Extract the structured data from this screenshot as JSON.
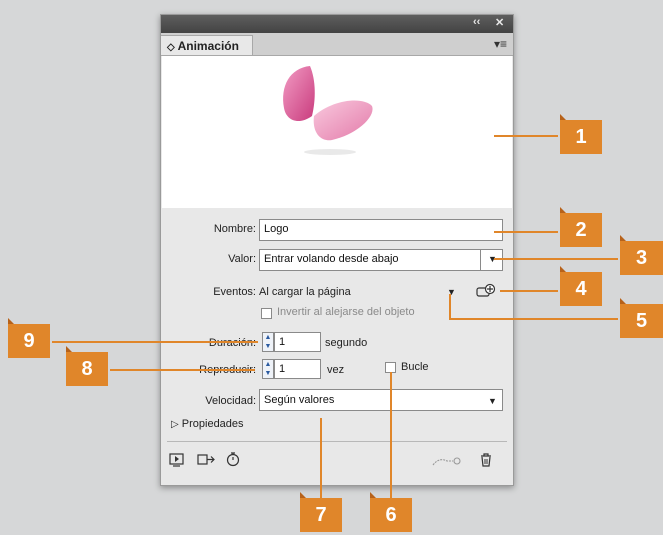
{
  "panel": {
    "tab_label": "Animación",
    "tab_arrows": "◇",
    "collapse_icon": "‹‹",
    "close_icon": "✕",
    "menu_icon": "▾≡"
  },
  "form": {
    "name_label": "Nombre:",
    "name_value": "Logo",
    "value_label": "Valor:",
    "value_value": "Entrar volando desde abajo",
    "events_label": "Eventos:",
    "events_value": "Al cargar la página",
    "invert_label": "Invertir al alejarse del objeto",
    "duration_label": "Duración:",
    "duration_value": "1",
    "duration_unit": "segundo",
    "repeat_label": "Reproducir:",
    "repeat_value": "1",
    "repeat_unit": "vez",
    "loop_label": "Bucle",
    "speed_label": "Velocidad:",
    "speed_value": "Según valores",
    "properties_label": "Propiedades"
  },
  "callouts": [
    "1",
    "2",
    "3",
    "4",
    "5",
    "6",
    "7",
    "8",
    "9"
  ],
  "colors": {
    "callout": "#e0862a",
    "butterfly": "#d94f8f"
  }
}
